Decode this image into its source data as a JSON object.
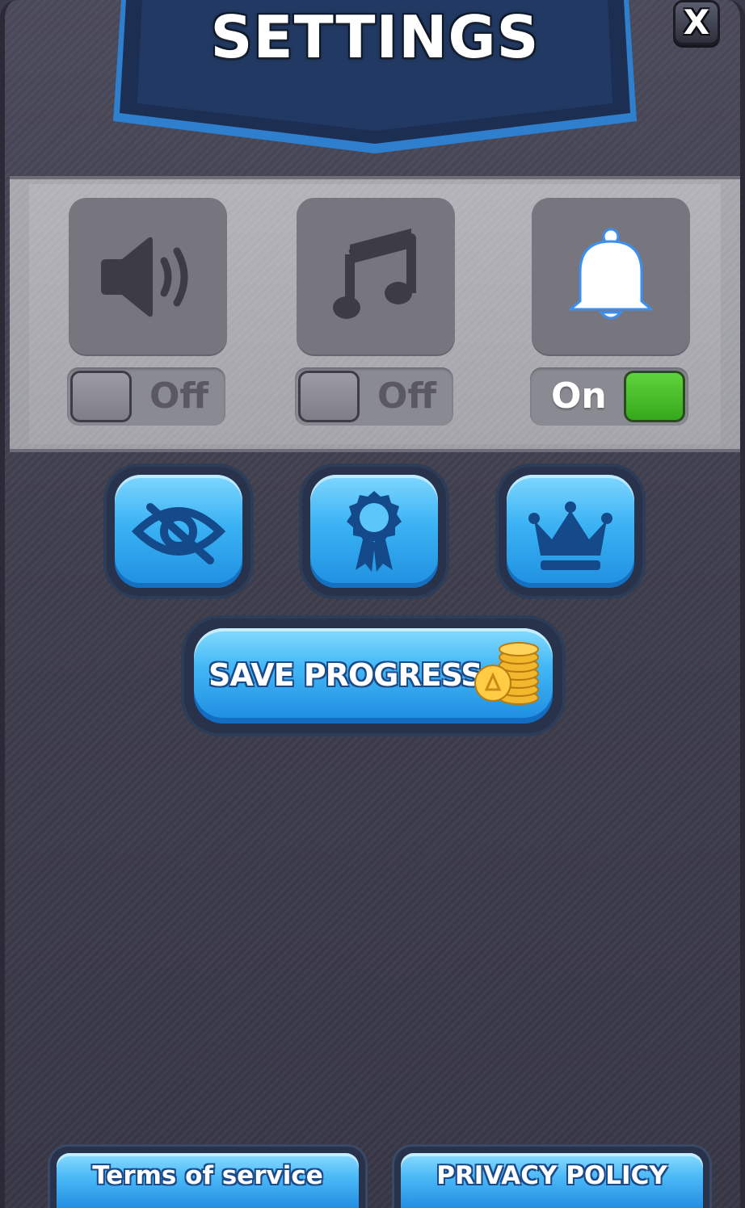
{
  "header": {
    "title": "SETTINGS"
  },
  "close": {
    "label": "X"
  },
  "toggles": [
    {
      "name": "sound",
      "state": "Off",
      "icon": "speaker-icon"
    },
    {
      "name": "music",
      "state": "Off",
      "icon": "music-note-icon"
    },
    {
      "name": "notifications",
      "state": "On",
      "icon": "bell-icon"
    }
  ],
  "action_buttons": [
    {
      "icon": "eye-slash-icon"
    },
    {
      "icon": "ribbon-award-icon"
    },
    {
      "icon": "crown-icon"
    }
  ],
  "save_progress": {
    "label": "SAVE PROGRESS +",
    "icon": "coin-stack-icon"
  },
  "footer": {
    "terms_label": "Terms of service",
    "privacy_label": "PRIVACY POLICY"
  },
  "colors": {
    "accent_blue": "#3ab2f4",
    "toggle_on": "#35a81c",
    "panel": "#3d3c4b",
    "ribbon": "#1c2f52"
  }
}
